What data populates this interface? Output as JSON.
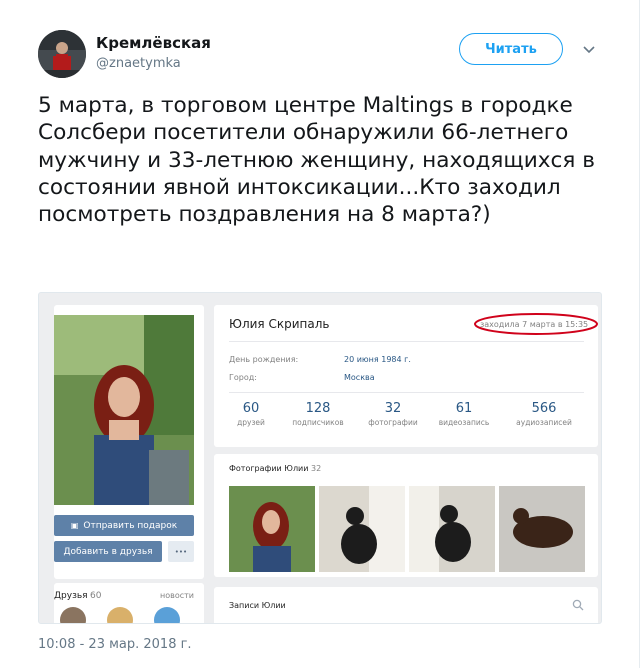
{
  "tweet": {
    "display_name": "Кремлёвская",
    "handle": "@znaetymka",
    "follow_label": "Читать",
    "text": "5 марта, в торговом центре Maltings в городке Солсбери посетители обнаружили 66-летнего мужчину и 33-летнюю женщину, находящихся в состоянии явной интоксикации...Кто заходил посмотреть поздравления на 8 марта?)",
    "timestamp": "10:08 - 23 мар. 2018 г."
  },
  "vk": {
    "name": "Юлия Скрипаль",
    "last_seen": "заходила 7 марта в 15:35",
    "birthday_label": "День рождения:",
    "birthday_value": "20 июня 1984 г.",
    "city_label": "Город:",
    "city_value": "Москва",
    "stats": [
      {
        "num": "60",
        "label": "друзей"
      },
      {
        "num": "128",
        "label": "подписчиков"
      },
      {
        "num": "32",
        "label": "фотографии"
      },
      {
        "num": "61",
        "label": "видеозапись"
      },
      {
        "num": "566",
        "label": "аудиозаписей"
      }
    ],
    "gift_button": "Отправить подарок",
    "add_friend_button": "Добавить в друзья",
    "more_button": "•••",
    "friends_label": "Друзья",
    "friends_count": "60",
    "news_label": "новости",
    "photos_label": "Фотографии Юлии",
    "photos_count": "32",
    "wall_label": "Записи Юлии"
  },
  "colors": {
    "twitter_blue": "#1da1f2",
    "vk_blue": "#5e81a8",
    "vk_link": "#2a5885",
    "highlight_circle": "#d0021b"
  }
}
